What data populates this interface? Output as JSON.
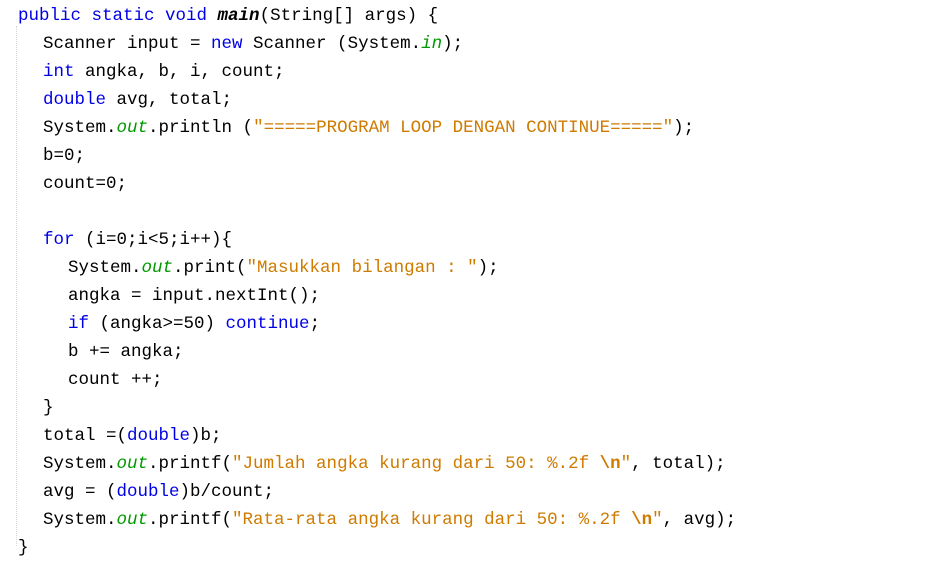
{
  "editor": {
    "language": "java",
    "lines": [
      {
        "indent": 0,
        "tokens": [
          {
            "t": "public static void ",
            "c": "kw"
          },
          {
            "t": "main",
            "c": "bold"
          },
          {
            "t": "(String[] args) {",
            "c": "plain"
          }
        ]
      },
      {
        "indent": 1,
        "tokens": [
          {
            "t": "Scanner input = ",
            "c": "plain"
          },
          {
            "t": "new",
            "c": "kw"
          },
          {
            "t": " Scanner (System.",
            "c": "plain"
          },
          {
            "t": "in",
            "c": "fld"
          },
          {
            "t": ");",
            "c": "plain"
          }
        ]
      },
      {
        "indent": 1,
        "tokens": [
          {
            "t": "int",
            "c": "kw"
          },
          {
            "t": " angka, b, i, count;",
            "c": "plain"
          }
        ]
      },
      {
        "indent": 1,
        "tokens": [
          {
            "t": "double",
            "c": "kw"
          },
          {
            "t": " avg, total;",
            "c": "plain"
          }
        ]
      },
      {
        "indent": 1,
        "tokens": [
          {
            "t": "System.",
            "c": "plain"
          },
          {
            "t": "out",
            "c": "fld"
          },
          {
            "t": ".println (",
            "c": "plain"
          },
          {
            "t": "\"=====PROGRAM LOOP DENGAN CONTINUE=====\"",
            "c": "str"
          },
          {
            "t": ");",
            "c": "plain"
          }
        ]
      },
      {
        "indent": 1,
        "tokens": [
          {
            "t": "b=0;",
            "c": "plain"
          }
        ]
      },
      {
        "indent": 1,
        "tokens": [
          {
            "t": "count=0;",
            "c": "plain"
          }
        ]
      },
      {
        "indent": 0,
        "tokens": []
      },
      {
        "indent": 1,
        "tokens": [
          {
            "t": "for",
            "c": "kw"
          },
          {
            "t": " (i=0;i<5;i++){",
            "c": "plain"
          }
        ]
      },
      {
        "indent": 2,
        "tokens": [
          {
            "t": "System.",
            "c": "plain"
          },
          {
            "t": "out",
            "c": "fld"
          },
          {
            "t": ".print(",
            "c": "plain"
          },
          {
            "t": "\"Masukkan bilangan : \"",
            "c": "str"
          },
          {
            "t": ");",
            "c": "plain"
          }
        ]
      },
      {
        "indent": 2,
        "tokens": [
          {
            "t": "angka = input.nextInt();",
            "c": "plain"
          }
        ]
      },
      {
        "indent": 2,
        "tokens": [
          {
            "t": "if",
            "c": "kw"
          },
          {
            "t": " (angka>=50) ",
            "c": "plain"
          },
          {
            "t": "continue",
            "c": "kw"
          },
          {
            "t": ";",
            "c": "plain"
          }
        ]
      },
      {
        "indent": 2,
        "tokens": [
          {
            "t": "b += angka;",
            "c": "plain"
          }
        ]
      },
      {
        "indent": 2,
        "tokens": [
          {
            "t": "count ++;",
            "c": "plain"
          }
        ]
      },
      {
        "indent": 1,
        "tokens": [
          {
            "t": "}",
            "c": "plain"
          }
        ]
      },
      {
        "indent": 1,
        "tokens": [
          {
            "t": "total =(",
            "c": "plain"
          },
          {
            "t": "double",
            "c": "kw"
          },
          {
            "t": ")b;",
            "c": "plain"
          }
        ]
      },
      {
        "indent": 1,
        "tokens": [
          {
            "t": "System.",
            "c": "plain"
          },
          {
            "t": "out",
            "c": "fld"
          },
          {
            "t": ".printf(",
            "c": "plain"
          },
          {
            "t": "\"Jumlah angka kurang dari 50: %.2f ",
            "c": "str"
          },
          {
            "t": "\\n",
            "c": "esc"
          },
          {
            "t": "\"",
            "c": "str"
          },
          {
            "t": ", total);",
            "c": "plain"
          }
        ]
      },
      {
        "indent": 1,
        "tokens": [
          {
            "t": "avg = (",
            "c": "plain"
          },
          {
            "t": "double",
            "c": "kw"
          },
          {
            "t": ")b/count;",
            "c": "plain"
          }
        ]
      },
      {
        "indent": 1,
        "tokens": [
          {
            "t": "System.",
            "c": "plain"
          },
          {
            "t": "out",
            "c": "fld"
          },
          {
            "t": ".printf(",
            "c": "plain"
          },
          {
            "t": "\"Rata-rata angka kurang dari 50: %.2f ",
            "c": "str"
          },
          {
            "t": "\\n",
            "c": "esc"
          },
          {
            "t": "\"",
            "c": "str"
          },
          {
            "t": ", avg);",
            "c": "plain"
          }
        ]
      },
      {
        "indent": 0,
        "tokens": [
          {
            "t": "}",
            "c": "plain"
          }
        ]
      }
    ]
  }
}
